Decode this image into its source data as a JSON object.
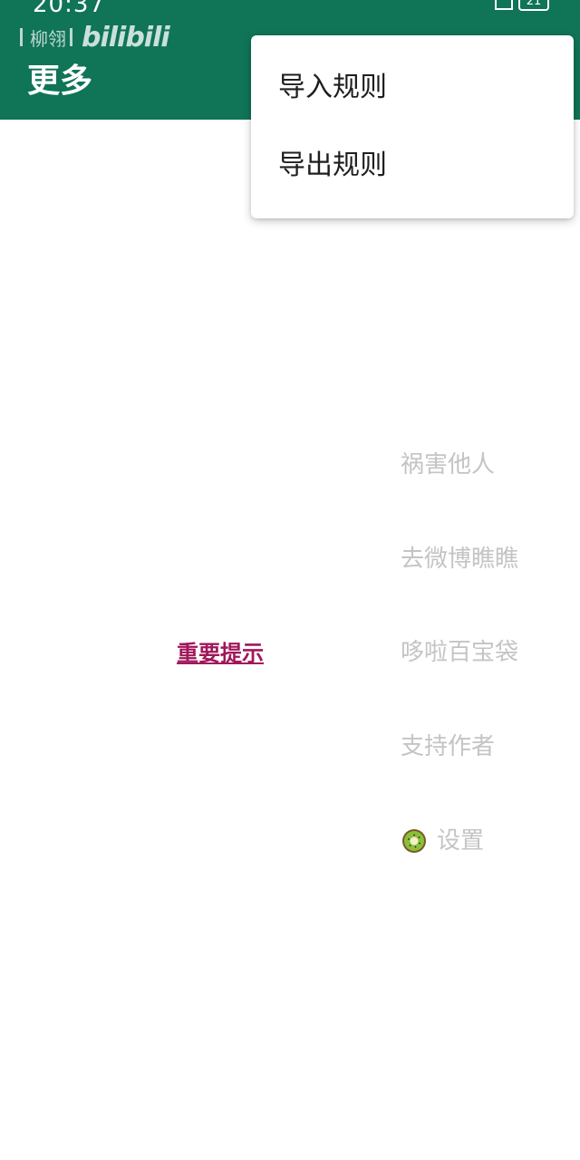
{
  "status_bar": {
    "time": "20:37",
    "battery": "21"
  },
  "watermark": {
    "author": "柳翎",
    "brand": "bilibili"
  },
  "header": {
    "title": "更多",
    "background_color": "#107457"
  },
  "menu": {
    "items": [
      {
        "label": "导入规则"
      },
      {
        "label": "导出规则"
      }
    ]
  },
  "main": {
    "notice_link": "重要提示",
    "notice_color": "#a0175a",
    "side_items": [
      {
        "label": "祸害他人"
      },
      {
        "label": "去微博瞧瞧"
      },
      {
        "label": "哆啦百宝袋"
      },
      {
        "label": "支持作者"
      },
      {
        "label": "设置",
        "icon": "kiwi-icon"
      }
    ]
  }
}
